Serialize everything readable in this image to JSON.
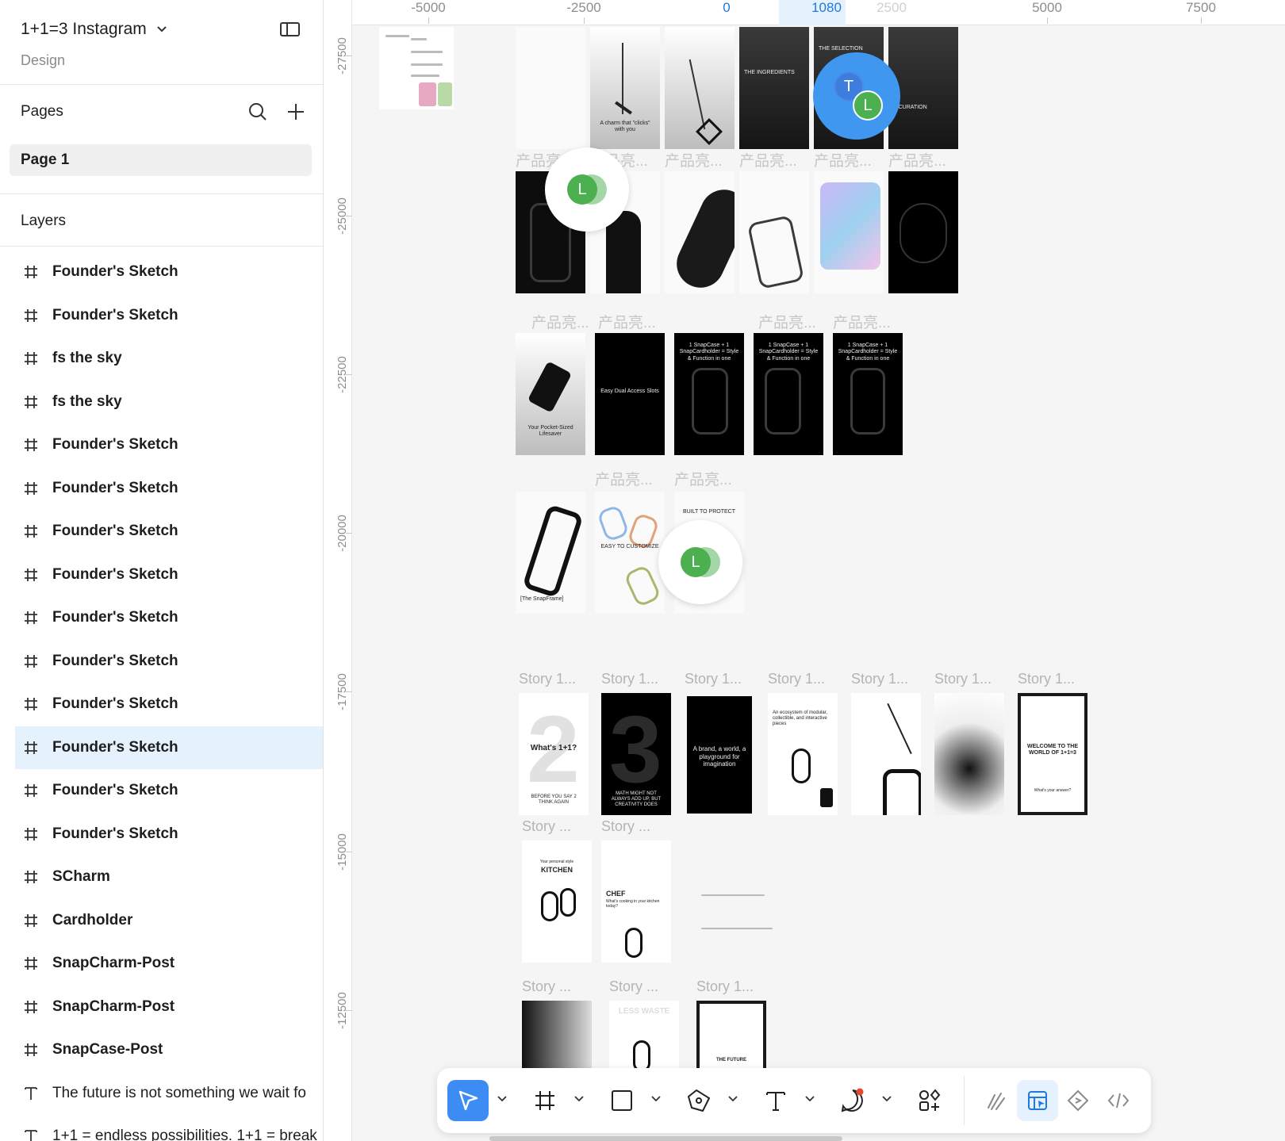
{
  "file": {
    "title": "1+1=3 Instagram",
    "subtitle": "Design"
  },
  "pages": {
    "title": "Pages",
    "items": [
      "Page 1"
    ]
  },
  "layers": {
    "title": "Layers",
    "items": [
      {
        "label": "Founder's Sketch",
        "type": "frame"
      },
      {
        "label": "Founder's Sketch",
        "type": "frame"
      },
      {
        "label": "fs the sky",
        "type": "frame"
      },
      {
        "label": "fs the sky",
        "type": "frame"
      },
      {
        "label": "Founder's Sketch",
        "type": "frame"
      },
      {
        "label": "Founder's Sketch",
        "type": "frame"
      },
      {
        "label": "Founder's Sketch",
        "type": "frame"
      },
      {
        "label": "Founder's Sketch",
        "type": "frame"
      },
      {
        "label": "Founder's Sketch",
        "type": "frame"
      },
      {
        "label": "Founder's Sketch",
        "type": "frame"
      },
      {
        "label": "Founder's Sketch",
        "type": "frame"
      },
      {
        "label": "Founder's Sketch",
        "type": "frame",
        "selected": true
      },
      {
        "label": "Founder's Sketch",
        "type": "frame"
      },
      {
        "label": "Founder's Sketch",
        "type": "frame"
      },
      {
        "label": " SCharm",
        "type": "frame"
      },
      {
        "label": "Cardholder",
        "type": "frame"
      },
      {
        "label": "SnapCharm-Post",
        "type": "frame"
      },
      {
        "label": "SnapCharm-Post",
        "type": "frame"
      },
      {
        "label": "SnapCase-Post",
        "type": "frame"
      },
      {
        "label": "The future is not something we wait fo",
        "type": "text"
      },
      {
        "label": "1+1 = endless possibilities. 1+1 = break",
        "type": "text"
      }
    ]
  },
  "rulers": {
    "x": [
      "-5000",
      "-2500",
      "0",
      "1080",
      "2500",
      "5000",
      "7500"
    ],
    "y": [
      "-27500",
      "-25000",
      "-22500",
      "-20000",
      "-17500",
      "-15000",
      "-12500"
    ]
  },
  "canvas_labels": {
    "product_short": "产品亮...",
    "story_long": "Story 1...",
    "story_short": "Story ...",
    "frame_texts": {
      "charm_clicks": "A charm that \"clicks\" with you",
      "the_selection": "THE SELECTION",
      "the_ingredients": "THE INGREDIENTS",
      "curation": "E CURATION",
      "pocket_lifesaver": "Your Pocket-Sized Lifesaver",
      "easy_dual": "Easy Dual Access Slots",
      "snapcase_card": "1 SnapCase + 1 SnapCardholder = Style & Function in one",
      "snapframe": "[The SnapFrame]",
      "easy_customize": "EASY TO CUSTOMIZE",
      "built_to_protect": "BUILT TO PROTECT",
      "whats_1p1": "What's 1+1?",
      "before_you_say": "BEFORE YOU SAY 2 THINK AGAIN",
      "math_might_not": "MATH MIGHT NOT ALWAYS ADD UP, BUT CREATIVITY DOES",
      "brand_world": "A brand, a world, a playground for imagination",
      "ecosystem": "An ecosystem of modular, collectible, and interactive pieces",
      "welcome": "WELCOME TO THE WORLD OF 1+1=3",
      "whats_answer": "What's your answer?",
      "kitchen": "KITCHEN",
      "your_personal": "Your personal style",
      "chef": "CHEF",
      "chef_sub": "What's cooking in your kitchen today?",
      "the_future": "THE FUTURE",
      "less_waste": "LESS WASTE"
    }
  },
  "collaborators": [
    {
      "initial": "T",
      "color": "#3d7ddb"
    },
    {
      "initial": "L",
      "color": "#4caf50"
    }
  ],
  "cursor_color": "#4097f0",
  "accent": "#3d8cf3"
}
